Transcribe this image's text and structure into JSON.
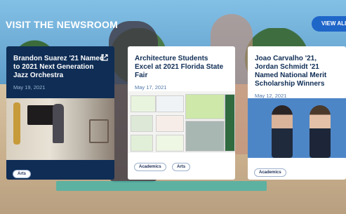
{
  "section": {
    "heading": "VISIT THE NEWSROOM",
    "view_all_label": "VIEW ALL"
  },
  "cards": [
    {
      "title": "Brandon Suarez '21 Named to 2021 Next Generation Jazz Orchestra",
      "date": "May 19, 2021",
      "tags": [
        "Arts"
      ],
      "icon": "external-link-icon"
    },
    {
      "title": "Architecture Students Excel at 2021 Florida State Fair",
      "date": "May 17, 2021",
      "tags": [
        "Academics",
        "Arts"
      ]
    },
    {
      "title": "Joao Carvalho '21, Jordan Schmidt '21 Named National Merit Scholarship Winners",
      "date": "May 12, 2021",
      "tags": [
        "Academics"
      ]
    }
  ],
  "colors": {
    "navy": "#0f2d55",
    "accent_blue": "#1f66c9",
    "date_blue": "#5077aa",
    "tag_border": "#9db1cc"
  }
}
